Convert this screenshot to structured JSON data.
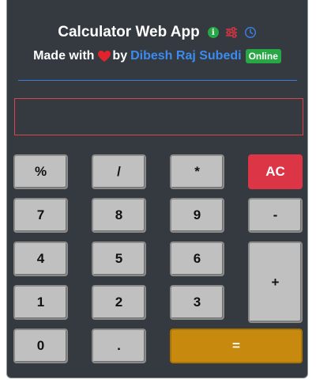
{
  "header": {
    "title": "Calculator Web App",
    "made_with": "Made with",
    "by": "by",
    "author": "Dibesh Raj Subedi",
    "status_badge": "Online",
    "icons": [
      "info-icon",
      "sliders-icon",
      "history-icon",
      "heart-icon"
    ],
    "colors": {
      "info": "#28a745",
      "sliders": "#dc3545",
      "history": "#3b7ddd",
      "heart": "#e0242b",
      "author": "#3b8bf0"
    }
  },
  "display": {
    "value": ""
  },
  "keypad": {
    "percent": "%",
    "divide": "/",
    "multiply": "*",
    "clear": "AC",
    "seven": "7",
    "eight": "8",
    "nine": "9",
    "minus": "-",
    "four": "4",
    "five": "5",
    "six": "6",
    "plus": "+",
    "one": "1",
    "two": "2",
    "three": "3",
    "zero": "0",
    "decimal": ".",
    "equals": "="
  },
  "colors": {
    "panel": "#343a40",
    "key": "#c0c0c0",
    "clear_key": "#dc3545",
    "equals_key": "#c88a0e",
    "divider": "#3b7ddd",
    "display_border": "#d9444a"
  }
}
